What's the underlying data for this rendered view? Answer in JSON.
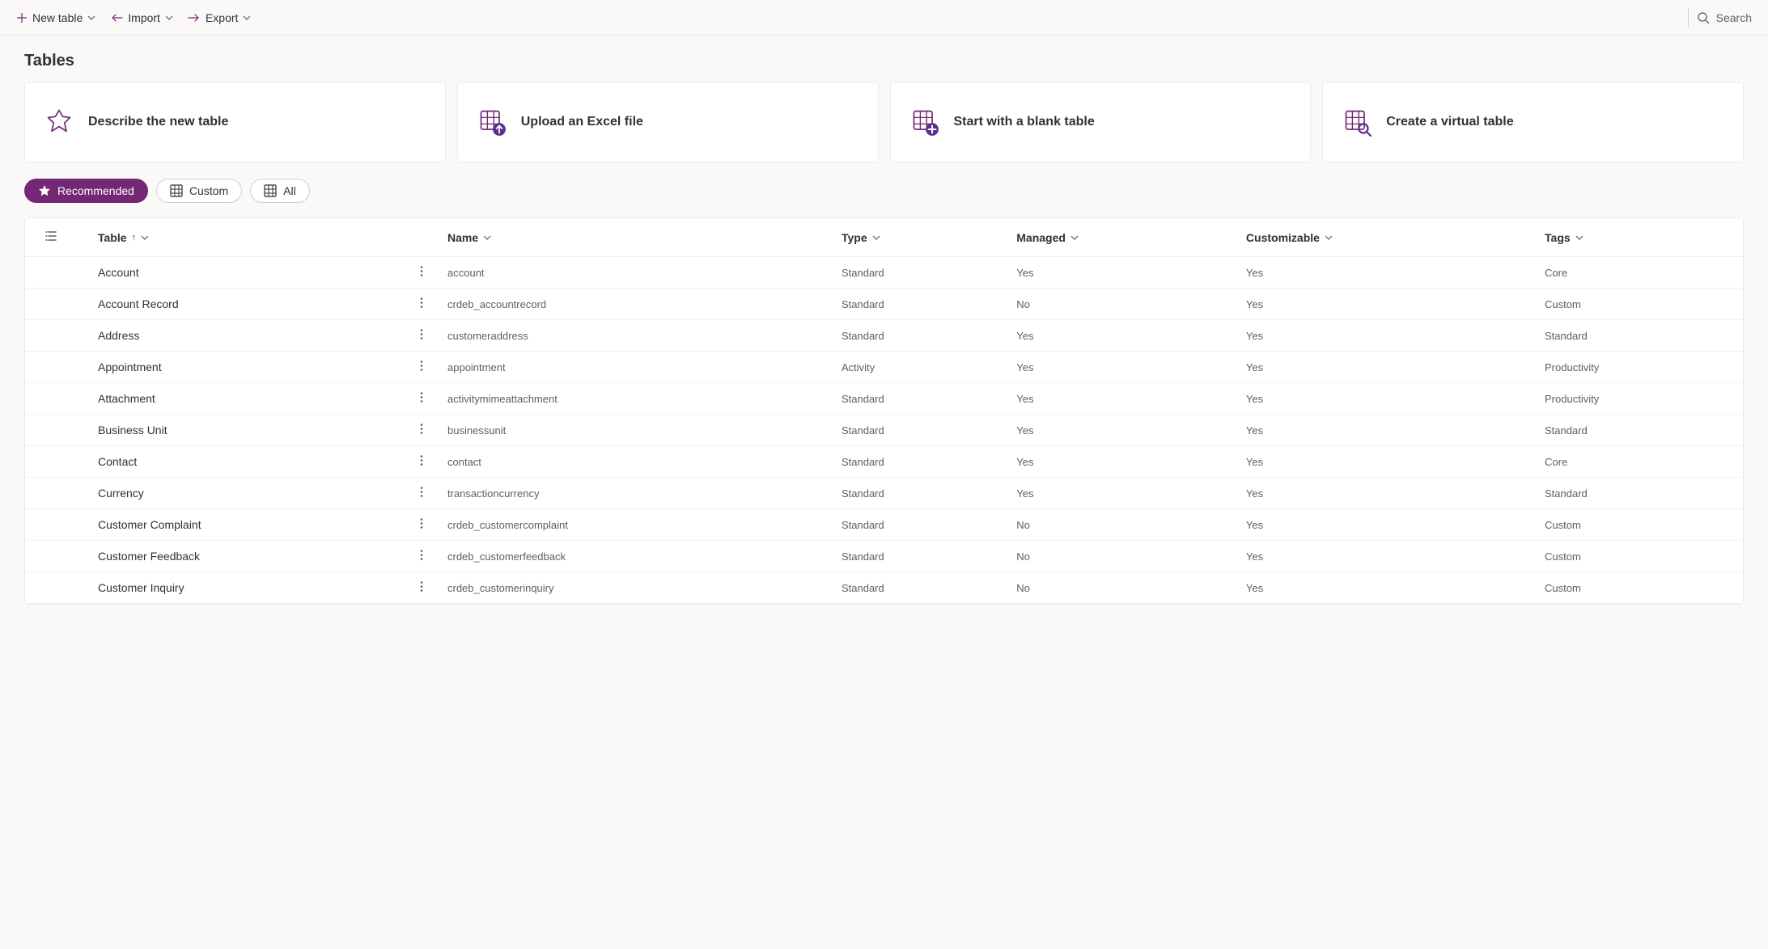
{
  "toolbar": {
    "new_table": "New table",
    "import": "Import",
    "export": "Export",
    "search_placeholder": "Search"
  },
  "page": {
    "title": "Tables"
  },
  "cards": [
    {
      "label": "Describe the new table"
    },
    {
      "label": "Upload an Excel file"
    },
    {
      "label": "Start with a blank table"
    },
    {
      "label": "Create a virtual table"
    }
  ],
  "pills": {
    "recommended": "Recommended",
    "custom": "Custom",
    "all": "All"
  },
  "columns": {
    "table": "Table",
    "name": "Name",
    "type": "Type",
    "managed": "Managed",
    "customizable": "Customizable",
    "tags": "Tags"
  },
  "rows": [
    {
      "table": "Account",
      "name": "account",
      "type": "Standard",
      "managed": "Yes",
      "customizable": "Yes",
      "tags": "Core"
    },
    {
      "table": "Account Record",
      "name": "crdeb_accountrecord",
      "type": "Standard",
      "managed": "No",
      "customizable": "Yes",
      "tags": "Custom"
    },
    {
      "table": "Address",
      "name": "customeraddress",
      "type": "Standard",
      "managed": "Yes",
      "customizable": "Yes",
      "tags": "Standard"
    },
    {
      "table": "Appointment",
      "name": "appointment",
      "type": "Activity",
      "managed": "Yes",
      "customizable": "Yes",
      "tags": "Productivity"
    },
    {
      "table": "Attachment",
      "name": "activitymimeattachment",
      "type": "Standard",
      "managed": "Yes",
      "customizable": "Yes",
      "tags": "Productivity"
    },
    {
      "table": "Business Unit",
      "name": "businessunit",
      "type": "Standard",
      "managed": "Yes",
      "customizable": "Yes",
      "tags": "Standard"
    },
    {
      "table": "Contact",
      "name": "contact",
      "type": "Standard",
      "managed": "Yes",
      "customizable": "Yes",
      "tags": "Core"
    },
    {
      "table": "Currency",
      "name": "transactioncurrency",
      "type": "Standard",
      "managed": "Yes",
      "customizable": "Yes",
      "tags": "Standard"
    },
    {
      "table": "Customer Complaint",
      "name": "crdeb_customercomplaint",
      "type": "Standard",
      "managed": "No",
      "customizable": "Yes",
      "tags": "Custom"
    },
    {
      "table": "Customer Feedback",
      "name": "crdeb_customerfeedback",
      "type": "Standard",
      "managed": "No",
      "customizable": "Yes",
      "tags": "Custom"
    },
    {
      "table": "Customer Inquiry",
      "name": "crdeb_customerinquiry",
      "type": "Standard",
      "managed": "No",
      "customizable": "Yes",
      "tags": "Custom"
    }
  ]
}
